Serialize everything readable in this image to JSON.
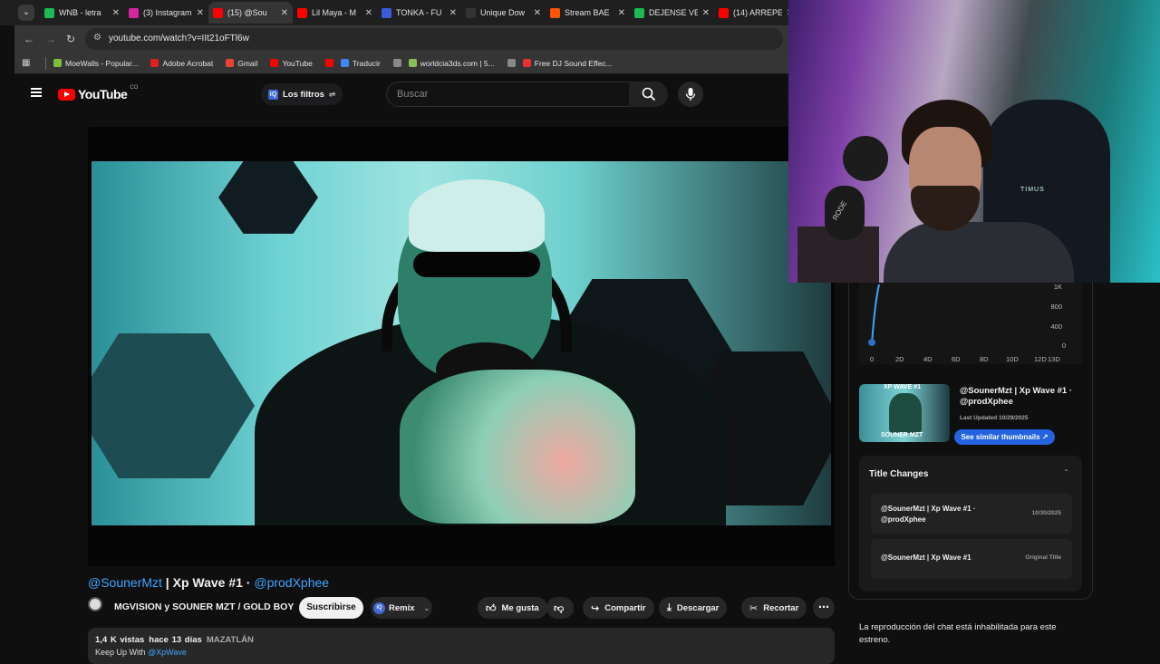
{
  "browser": {
    "tabs": [
      {
        "title": "WNB - letra",
        "color": "#1db954",
        "active": false
      },
      {
        "title": "(3) Instagram",
        "color": "#d6249f",
        "active": false
      },
      {
        "title": "(15) @Sou",
        "color": "#ff0000",
        "active": true
      },
      {
        "title": "Lil Maya - M",
        "color": "#ff0000",
        "active": false
      },
      {
        "title": "TONKA - FU",
        "color": "#3b5bdb",
        "active": false
      },
      {
        "title": "Unique Dow",
        "color": "#333333",
        "active": false
      },
      {
        "title": "Stream BAE",
        "color": "#ff5500",
        "active": false
      },
      {
        "title": "DEJENSE VE",
        "color": "#1db954",
        "active": false
      },
      {
        "title": "(14) ARREPE",
        "color": "#ff0000",
        "active": false
      }
    ],
    "url": "youtube.com/watch?v=IIt21oFTl6w",
    "bookmarks": [
      {
        "label": "MoeWalls - Popular...",
        "color": "#7bbf3a"
      },
      {
        "label": "Adobe Acrobat",
        "color": "#e02020"
      },
      {
        "label": "Gmail",
        "color": "#ea4335"
      },
      {
        "label": "YouTube",
        "color": "#ff0000"
      },
      {
        "label": "",
        "color": "#ff0000"
      },
      {
        "label": "Traducir",
        "color": "#4285f4"
      },
      {
        "label": "",
        "color": "#888888"
      },
      {
        "label": "worldcia3ds.com | 5...",
        "color": "#8bbf5a"
      },
      {
        "label": "",
        "color": "#888888"
      },
      {
        "label": "Free DJ Sound Effec...",
        "color": "#e83030"
      }
    ]
  },
  "youtube": {
    "logo_text": "YouTube",
    "country": "CO",
    "filters_label": "Los filtros",
    "search_placeholder": "Buscar"
  },
  "video": {
    "title_tag1": "@SounerMzt",
    "title_mid": " | Xp Wave #1 · ",
    "title_tag2": "@prodXphee",
    "channel": "MGVISION y SOUNER MZT / GOLD BOY",
    "subscribe": "Suscribirse",
    "remix": "Remix",
    "like": "Me gusta",
    "share": "Compartir",
    "download": "Descargar",
    "clip": "Recortar",
    "views": "1,4 K vistas",
    "age": "hace 13 días",
    "location": "MAZATLÁN",
    "desc_prefix": "Keep Up With ",
    "desc_tag": "@XpWave"
  },
  "sidebar": {
    "graph_y": [
      "1K",
      "800",
      "400",
      "0"
    ],
    "graph_x": [
      "0",
      "2D",
      "4D",
      "6D",
      "8D",
      "10D",
      "12D",
      "13D"
    ],
    "thumb_top_text": "XP WAVE #1",
    "thumb_bottom_text": "SOUNER MZT",
    "thumb_title": "@SounerMzt | Xp Wave #1 · @prodXphee",
    "last_updated": "Last Updated 10/29/2025",
    "similar_button": "See similar thumbnails ↗",
    "title_changes_heading": "Title Changes",
    "title_changes": [
      {
        "title": "@SounerMzt | Xp Wave #1 · @prodXphee",
        "date": "10/30/2025"
      },
      {
        "title": "@SounerMzt | Xp Wave #1",
        "date": "Original Title"
      }
    ],
    "chat_message": "La reproducción del chat está inhabilitada para este estreno."
  },
  "webcam": {
    "mic_brand": "RODE",
    "chair_brand": "TIMUS"
  }
}
